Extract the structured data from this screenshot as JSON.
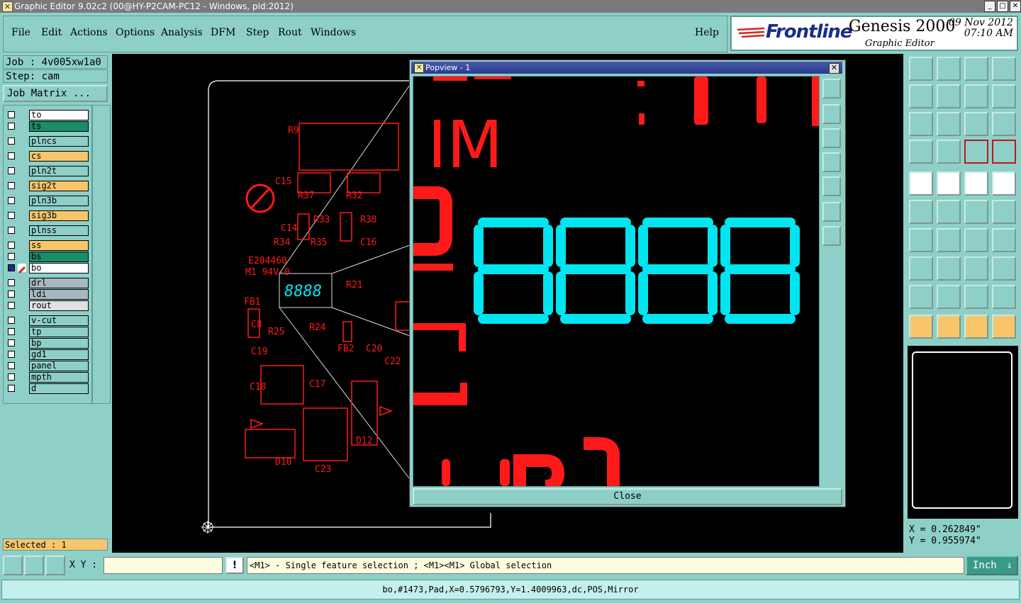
{
  "window": {
    "title": "Graphic Editor 9.02c2 (00@HY-P2CAM-PC12 - Windows, pid:2012)",
    "min": "_",
    "max": "□",
    "close": "✕"
  },
  "menu": {
    "items": [
      "File",
      "Edit",
      "Actions",
      "Options",
      "Analysis",
      "DFM",
      "Step",
      "Rout",
      "Windows"
    ],
    "help": "Help"
  },
  "brand": {
    "logo": "Frontline",
    "product": "Genesis 2000",
    "subtitle": "Graphic Editor",
    "date": "09 Nov 2012",
    "time": "07:10 AM"
  },
  "job": {
    "job_label": "Job : 4v005xw1a0",
    "step_label": "Step: cam",
    "matrix_button": "Job Matrix ..."
  },
  "layers": [
    {
      "name": "to",
      "color": "#ffffff"
    },
    {
      "name": "ts",
      "color": "#1a8c66"
    },
    {
      "name": "plncs",
      "color": "#8ed0c8"
    },
    {
      "name": "cs",
      "color": "#f8c56b"
    },
    {
      "name": "pln2t",
      "color": "#8ed0c8"
    },
    {
      "name": "sig2t",
      "color": "#f8c56b"
    },
    {
      "name": "pln3b",
      "color": "#8ed0c8"
    },
    {
      "name": "sig3b",
      "color": "#f8c56b"
    },
    {
      "name": "plnss",
      "color": "#8ed0c8"
    },
    {
      "name": "ss",
      "color": "#f8c56b"
    },
    {
      "name": "bs",
      "color": "#1a8c66"
    },
    {
      "name": "bo",
      "color": "#ffffff",
      "active": true
    },
    {
      "name": "drl",
      "color": "#a8b8c0"
    },
    {
      "name": "ldi",
      "color": "#a8b8c0"
    },
    {
      "name": "rout",
      "color": "#e0e0e0"
    },
    {
      "name": "v-cut",
      "color": "#8ed0c8"
    },
    {
      "name": "tp",
      "color": "#8ed0c8"
    },
    {
      "name": "bp",
      "color": "#8ed0c8"
    },
    {
      "name": "gd1",
      "color": "#8ed0c8"
    },
    {
      "name": "panel",
      "color": "#8ed0c8"
    },
    {
      "name": "mpth",
      "color": "#8ed0c8"
    },
    {
      "name": "d",
      "color": "#8ed0c8"
    }
  ],
  "selected_text": "Selected : 1",
  "popview": {
    "title": "Popview - 1",
    "close_label": "Close",
    "display_digits": "8888"
  },
  "board_labels": [
    "C15",
    "R37",
    "R32",
    "R33",
    "R38",
    "C14",
    "R34",
    "R35",
    "C16",
    "E204460",
    "M1 94V-0",
    "FB1",
    "C8",
    "C18",
    "C19",
    "R25",
    "C23",
    "D10",
    "D12",
    "C22",
    "R21",
    "R24",
    "FB2",
    "C20",
    "C17",
    "R9"
  ],
  "coords": {
    "x": "X = 0.262849\"",
    "y": "Y = 0.955974\""
  },
  "bottom": {
    "xy_label": "X Y :",
    "xy_value": "",
    "warn": "!",
    "message": "<M1> - Single feature selection ; <M1><M1> Global selection",
    "units": "Inch",
    "units_arrow": "⇓"
  },
  "status_line": "bo,#1473,Pad,X=0.5796793,Y=1.4009963,dc,POS,Mirror",
  "colors": {
    "background": "#8ed0c8",
    "feature_red": "#ff1a1a",
    "pad_cyan": "#00e5f0",
    "accent_orange": "#f8c56b",
    "title_blue": "#2a3a90"
  }
}
